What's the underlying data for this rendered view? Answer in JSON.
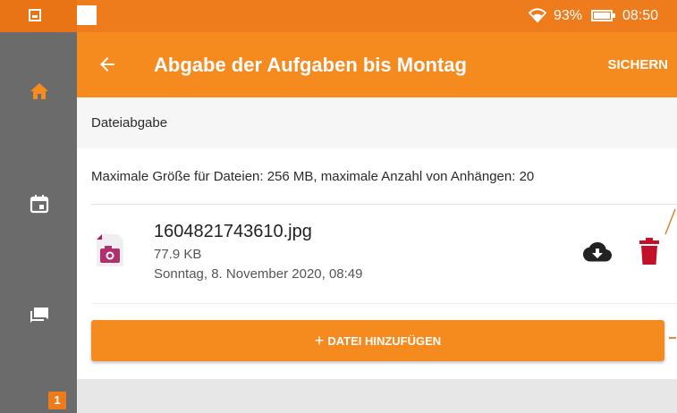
{
  "status_bar": {
    "battery_percent": "93%",
    "time": "08:50"
  },
  "sidebar": {
    "items": [
      {
        "icon": "home-icon"
      },
      {
        "icon": "calendar-icon"
      },
      {
        "icon": "messages-icon"
      }
    ],
    "badge_count": "1"
  },
  "appbar": {
    "title": "Abgabe der Aufgaben bis Montag",
    "save_label": "SICHERN"
  },
  "section": {
    "header": "Dateiabgabe",
    "info": "Maximale Größe für Dateien: 256 MB, maximale Anzahl von Anhängen: 20"
  },
  "file": {
    "name": "1604821743610.jpg",
    "size": "77.9 KB",
    "date": "Sonntag, 8. November 2020, 08:49",
    "icon": "image-file-icon"
  },
  "add_button": {
    "plus": "+",
    "label": "DATEI HINZUFÜGEN"
  },
  "colors": {
    "accent": "#f58a1f",
    "sidebar": "#6b6b6b",
    "delete": "#c0102a"
  }
}
